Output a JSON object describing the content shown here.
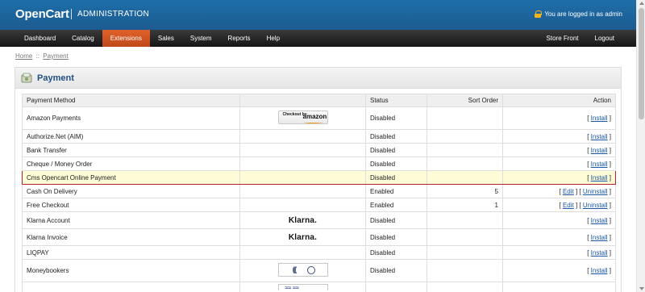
{
  "header": {
    "brand": "OpenCart",
    "section": "ADMINISTRATION",
    "login_text": "You are logged in as admin"
  },
  "menu": {
    "items": [
      "Dashboard",
      "Catalog",
      "Extensions",
      "Sales",
      "System",
      "Reports",
      "Help"
    ],
    "active": "Extensions",
    "right_items": [
      "Store Front",
      "Logout"
    ]
  },
  "breadcrumb": {
    "items": [
      "Home",
      "Payment"
    ],
    "separator": "::"
  },
  "panel": {
    "title": "Payment",
    "icon": "payment-icon"
  },
  "table": {
    "headers": [
      "Payment Method",
      "",
      "Status",
      "Sort Order",
      "Action"
    ],
    "rows": [
      {
        "name": "Amazon Payments",
        "logo": "Checkout by amazon",
        "logo_small": "Checkout by",
        "logo_big": "amazon",
        "status": "Disabled",
        "sort": "",
        "actions": [
          "Install"
        ]
      },
      {
        "name": "Authorize.Net (AIM)",
        "logo": "",
        "status": "Disabled",
        "sort": "",
        "actions": [
          "Install"
        ]
      },
      {
        "name": "Bank Transfer",
        "logo": "",
        "status": "Disabled",
        "sort": "",
        "actions": [
          "Install"
        ]
      },
      {
        "name": "Cheque / Money Order",
        "logo": "",
        "status": "Disabled",
        "sort": "",
        "actions": [
          "Install"
        ]
      },
      {
        "name": "Cms Opencart Online Payment",
        "logo": "",
        "status": "Disabled",
        "sort": "",
        "actions": [
          "Install"
        ],
        "highlighted": true
      },
      {
        "name": "Cash On Delivery",
        "logo": "",
        "status": "Enabled",
        "sort": "5",
        "actions": [
          "Edit",
          "Uninstall"
        ]
      },
      {
        "name": "Free Checkout",
        "logo": "",
        "status": "Enabled",
        "sort": "1",
        "actions": [
          "Edit",
          "Uninstall"
        ]
      },
      {
        "name": "Klarna Account",
        "logo": "Klarna.",
        "status": "Disabled",
        "sort": "",
        "actions": [
          "Install"
        ]
      },
      {
        "name": "Klarna Invoice",
        "logo": "Klarna.",
        "status": "Disabled",
        "sort": "",
        "actions": [
          "Install"
        ]
      },
      {
        "name": "LIQPAY",
        "logo": "",
        "status": "Disabled",
        "sort": "",
        "actions": [
          "Install"
        ]
      },
      {
        "name": "Moneybookers",
        "logo": "moneybookers",
        "status": "Disabled",
        "sort": "",
        "actions": [
          "Install"
        ]
      },
      {
        "name": "",
        "logo": "",
        "status": "",
        "sort": "",
        "actions": []
      }
    ]
  },
  "colors": {
    "header_blue": "#1f6ea9",
    "menu_active": "#e0622a",
    "title_blue": "#1f4f82",
    "link_blue": "#1a58a8",
    "highlight_bg": "#fdfcd6",
    "highlight_border": "#b5222a"
  }
}
